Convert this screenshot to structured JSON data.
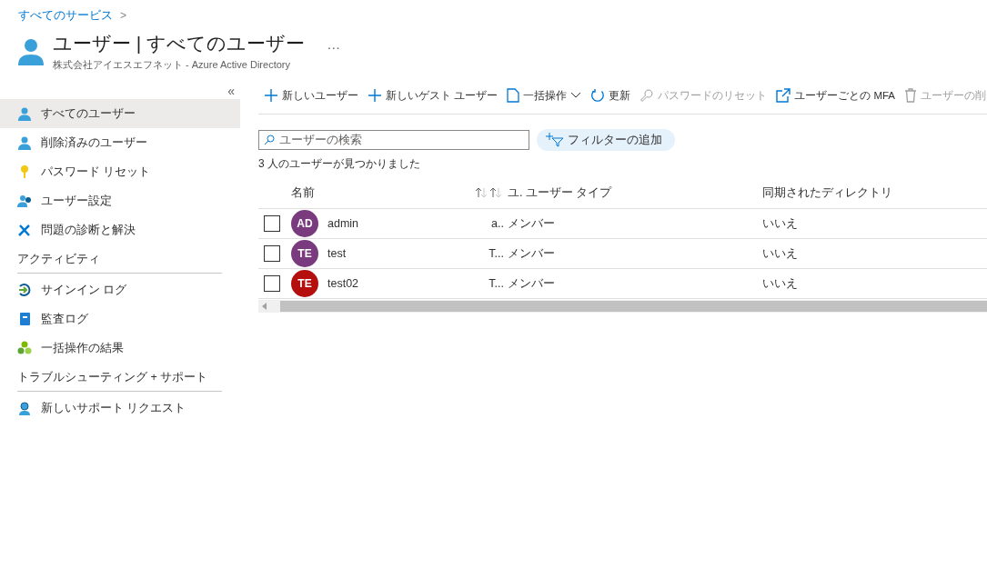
{
  "breadcrumb": {
    "label": "すべてのサービス",
    "separator": ">"
  },
  "header": {
    "title": "ユーザー | すべてのユーザー",
    "more": "…",
    "subtitle": "株式会社アイエスエフネット - Azure Active Directory"
  },
  "sidebar": {
    "collapse": "«",
    "sections": [
      {
        "items": [
          {
            "label": "すべてのユーザー",
            "kind": "user",
            "selected": true
          },
          {
            "label": "削除済みのユーザー",
            "kind": "user",
            "selected": false
          },
          {
            "label": "パスワード リセット",
            "kind": "key",
            "selected": false
          },
          {
            "label": "ユーザー設定",
            "kind": "usergear",
            "selected": false
          },
          {
            "label": "問題の診断と解決",
            "kind": "tools",
            "selected": false
          }
        ]
      },
      {
        "heading": "アクティビティ",
        "items": [
          {
            "label": "サインイン ログ",
            "kind": "signin",
            "selected": false
          },
          {
            "label": "監査ログ",
            "kind": "book",
            "selected": false
          },
          {
            "label": "一括操作の結果",
            "kind": "cluster",
            "selected": false
          }
        ]
      },
      {
        "heading": "トラブルシューティング + サポート",
        "items": [
          {
            "label": "新しいサポート リクエスト",
            "kind": "support",
            "selected": false
          }
        ]
      }
    ]
  },
  "toolbar": [
    {
      "label": "新しいユーザー",
      "kind": "plus",
      "disabled": false
    },
    {
      "label": "新しいゲスト ユーザー",
      "kind": "plus",
      "disabled": false
    },
    {
      "label": "一括操作",
      "kind": "doc",
      "disabled": false,
      "dropdown": true
    },
    {
      "label": "更新",
      "kind": "refresh",
      "disabled": false
    },
    {
      "label": "パスワードのリセット",
      "kind": "key",
      "disabled": true
    },
    {
      "label": "ユーザーごとの MFA",
      "kind": "external",
      "disabled": false
    },
    {
      "label": "ユーザーの削",
      "kind": "trash",
      "disabled": true
    }
  ],
  "search": {
    "placeholder": "ユーザーの検索"
  },
  "filter_button": "フィルターの追加",
  "result_count": "3 人のユーザーが見つかりました",
  "table": {
    "columns": [
      "名前",
      "ユ.",
      "ユーザー タイプ",
      "同期されたディレクトリ"
    ],
    "rows": [
      {
        "initials": "AD",
        "color": "#7a3b7e",
        "name": "admin",
        "column_2": "a..",
        "user_type": "メンバー",
        "synced": "いいえ",
        "checked": false
      },
      {
        "initials": "TE",
        "color": "#7a3b7e",
        "name": "test",
        "column_2": "T...",
        "user_type": "メンバー",
        "synced": "いいえ",
        "checked": false
      },
      {
        "initials": "TE",
        "color": "#b50e0e",
        "name": "test02",
        "column_2": "T...",
        "user_type": "メンバー",
        "synced": "いいえ",
        "checked": false
      }
    ]
  }
}
